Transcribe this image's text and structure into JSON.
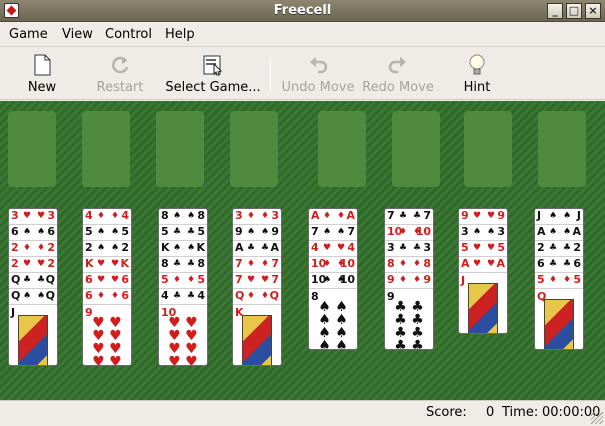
{
  "window": {
    "title": "Freecell"
  },
  "menubar": {
    "items": [
      {
        "label": "Game"
      },
      {
        "label": "View"
      },
      {
        "label": "Control"
      },
      {
        "label": "Help"
      }
    ]
  },
  "toolbar": {
    "new": {
      "label": "New",
      "icon": "document-icon"
    },
    "restart": {
      "label": "Restart",
      "icon": "restart-icon"
    },
    "select_game": {
      "label": "Select Game...",
      "icon": "select-game-icon"
    },
    "undo": {
      "label": "Undo Move",
      "icon": "undo-icon"
    },
    "redo": {
      "label": "Redo Move",
      "icon": "redo-icon"
    },
    "hint": {
      "label": "Hint",
      "icon": "lightbulb-icon"
    }
  },
  "columns": [
    {
      "cards": [
        {
          "rank": "3",
          "suit": "♥",
          "color": "red"
        },
        {
          "rank": "6",
          "suit": "♠",
          "color": "blk"
        },
        {
          "rank": "2",
          "suit": "♦",
          "color": "red"
        },
        {
          "rank": "2",
          "suit": "♥",
          "color": "red"
        },
        {
          "rank": "Q",
          "suit": "♣",
          "color": "blk"
        },
        {
          "rank": "Q",
          "suit": "♠",
          "color": "blk"
        }
      ],
      "top": {
        "rank": "J",
        "suit": "♣",
        "color": "blk",
        "court": true
      }
    },
    {
      "cards": [
        {
          "rank": "4",
          "suit": "♦",
          "color": "red"
        },
        {
          "rank": "5",
          "suit": "♠",
          "color": "blk"
        },
        {
          "rank": "2",
          "suit": "♠",
          "color": "blk"
        },
        {
          "rank": "K",
          "suit": "♥",
          "color": "red"
        },
        {
          "rank": "6",
          "suit": "♥",
          "color": "red"
        },
        {
          "rank": "6",
          "suit": "♦",
          "color": "red"
        }
      ],
      "top": {
        "rank": "9",
        "suit": "♥",
        "color": "red",
        "court": false
      }
    },
    {
      "cards": [
        {
          "rank": "8",
          "suit": "♠",
          "color": "blk"
        },
        {
          "rank": "5",
          "suit": "♣",
          "color": "blk"
        },
        {
          "rank": "K",
          "suit": "♠",
          "color": "blk"
        },
        {
          "rank": "8",
          "suit": "♣",
          "color": "blk"
        },
        {
          "rank": "5",
          "suit": "♦",
          "color": "red"
        },
        {
          "rank": "4",
          "suit": "♣",
          "color": "blk"
        }
      ],
      "top": {
        "rank": "10",
        "suit": "♥",
        "color": "red",
        "court": false
      }
    },
    {
      "cards": [
        {
          "rank": "3",
          "suit": "♦",
          "color": "red"
        },
        {
          "rank": "9",
          "suit": "♠",
          "color": "blk"
        },
        {
          "rank": "A",
          "suit": "♣",
          "color": "blk"
        },
        {
          "rank": "7",
          "suit": "♦",
          "color": "red"
        },
        {
          "rank": "7",
          "suit": "♥",
          "color": "red"
        },
        {
          "rank": "Q",
          "suit": "♦",
          "color": "red"
        }
      ],
      "top": {
        "rank": "K",
        "suit": "♦",
        "color": "red",
        "court": true
      }
    },
    {
      "cards": [
        {
          "rank": "A",
          "suit": "♦",
          "color": "red"
        },
        {
          "rank": "7",
          "suit": "♠",
          "color": "blk"
        },
        {
          "rank": "4",
          "suit": "♥",
          "color": "red"
        },
        {
          "rank": "10",
          "suit": "♦",
          "color": "red"
        },
        {
          "rank": "10",
          "suit": "♠",
          "color": "blk"
        }
      ],
      "top": {
        "rank": "8",
        "suit": "♠",
        "color": "blk",
        "court": false
      }
    },
    {
      "cards": [
        {
          "rank": "7",
          "suit": "♣",
          "color": "blk"
        },
        {
          "rank": "10",
          "suit": "♦",
          "color": "red"
        },
        {
          "rank": "3",
          "suit": "♣",
          "color": "blk"
        },
        {
          "rank": "8",
          "suit": "♦",
          "color": "red"
        },
        {
          "rank": "9",
          "suit": "♦",
          "color": "red"
        }
      ],
      "top": {
        "rank": "9",
        "suit": "♣",
        "color": "blk",
        "court": false
      }
    },
    {
      "cards": [
        {
          "rank": "9",
          "suit": "♥",
          "color": "red"
        },
        {
          "rank": "3",
          "suit": "♠",
          "color": "blk"
        },
        {
          "rank": "5",
          "suit": "♥",
          "color": "red"
        },
        {
          "rank": "A",
          "suit": "♥",
          "color": "red"
        }
      ],
      "top": {
        "rank": "J",
        "suit": "♥",
        "color": "red",
        "court": true
      }
    },
    {
      "cards": [
        {
          "rank": "J",
          "suit": "♠",
          "color": "blk"
        },
        {
          "rank": "A",
          "suit": "♠",
          "color": "blk"
        },
        {
          "rank": "2",
          "suit": "♣",
          "color": "blk"
        },
        {
          "rank": "6",
          "suit": "♣",
          "color": "blk"
        },
        {
          "rank": "5",
          "suit": "♦",
          "color": "red"
        }
      ],
      "top": {
        "rank": "Q",
        "suit": "♦",
        "color": "red",
        "court": true
      }
    }
  ],
  "status": {
    "score_label": "Score:",
    "score": "0",
    "time_label": "Time:",
    "time": "00:00:00"
  }
}
